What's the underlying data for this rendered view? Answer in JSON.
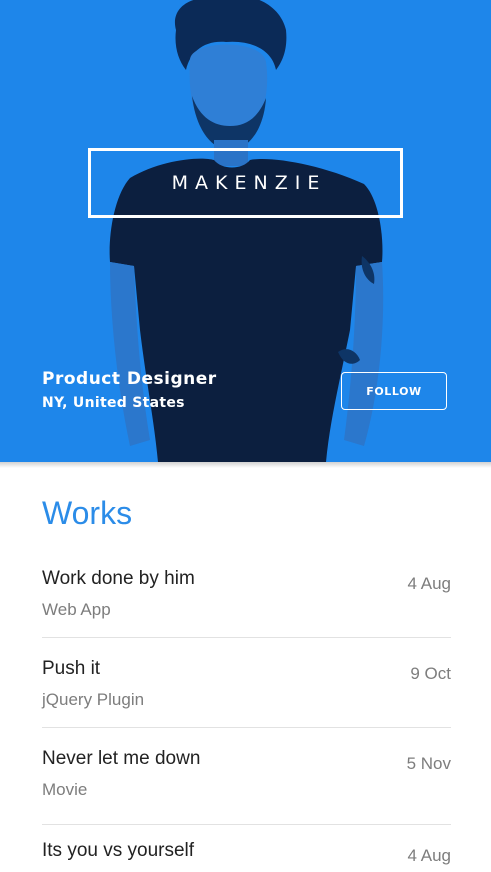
{
  "profile": {
    "name": "MAKENZIE",
    "title": "Product Designer",
    "location": "NY, United States",
    "follow_label": "FOLLOW"
  },
  "works": {
    "heading": "Works",
    "items": [
      {
        "title": "Work done by him",
        "subtitle": "Web App",
        "date": "4 Aug"
      },
      {
        "title": "Push it",
        "subtitle": "jQuery Plugin",
        "date": "9 Oct"
      },
      {
        "title": "Never let me down",
        "subtitle": "Movie",
        "date": "5 Nov"
      },
      {
        "title": "Its you vs yourself",
        "subtitle": "",
        "date": "4 Aug"
      }
    ]
  },
  "colors": {
    "hero_blue": "#1e86ea",
    "accent": "#2b8ce8"
  }
}
